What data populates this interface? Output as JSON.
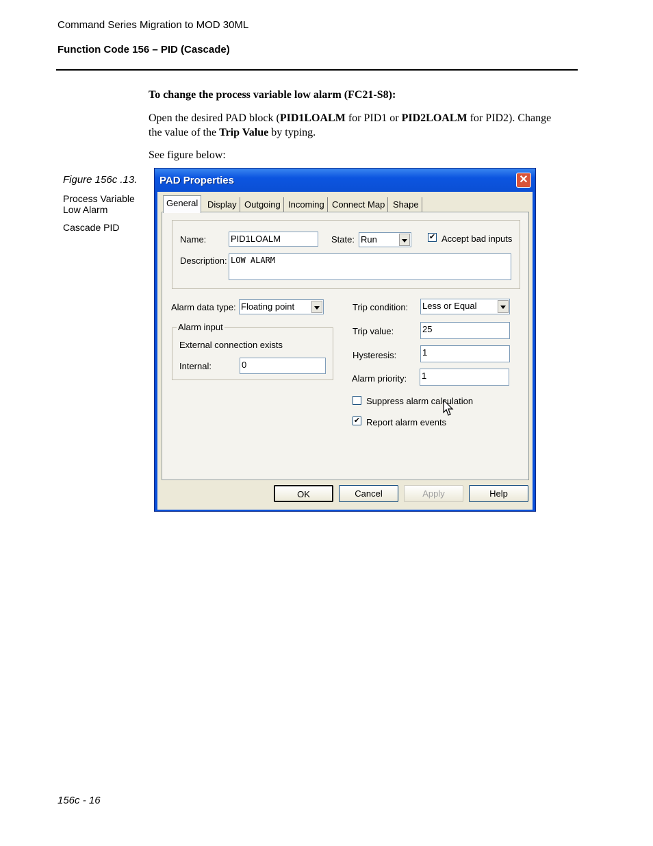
{
  "header": {
    "doc_title": "Command Series Migration to MOD 30ML",
    "section_title": "Function Code 156 – PID (Cascade)"
  },
  "body": {
    "heading": "To change the process variable low alarm (FC21-S8):",
    "para_open": "Open the desired PAD block (",
    "para_b1": "PID1LOALM",
    "para_mid1": " for PID1 or ",
    "para_b2": "PID2LOALM",
    "para_mid2": " for PID2). Change the value of the ",
    "para_b3": "Trip Value",
    "para_end": " by typing.",
    "see_figure": "See figure below:"
  },
  "caption": {
    "figure": "Figure 156c .13.",
    "line1": "Process Variable Low Alarm",
    "line2": "Cascade PID"
  },
  "dialog": {
    "title": "PAD Properties",
    "close_glyph": "✕",
    "tabs": [
      "General",
      "Display",
      "Outgoing",
      "Incoming",
      "Connect Map",
      "Shape"
    ],
    "name_label": "Name:",
    "name_value": "PID1LOALM",
    "state_label": "State:",
    "state_value": "Run",
    "accept_bad_label": "Accept bad inputs",
    "accept_bad_checked": true,
    "description_label": "Description:",
    "description_value": "LOW ALARM",
    "alarm_data_type_label": "Alarm data type:",
    "alarm_data_type_value": "Floating point",
    "alarm_input_legend": "Alarm input",
    "external_connection_text": "External connection exists",
    "internal_label": "Internal:",
    "internal_value": "0",
    "trip_condition_label": "Trip condition:",
    "trip_condition_value": "Less or Equal",
    "trip_value_label": "Trip value:",
    "trip_value": "25",
    "hysteresis_label": "Hysteresis:",
    "hysteresis_value": "1",
    "alarm_priority_label": "Alarm priority:",
    "alarm_priority_value": "1",
    "suppress_label": "Suppress alarm calculation",
    "suppress_checked": false,
    "report_label": "Report alarm events",
    "report_checked": true,
    "buttons": {
      "ok": "OK",
      "cancel": "Cancel",
      "apply": "Apply",
      "help": "Help"
    },
    "check_glyph": "✔"
  },
  "footer": {
    "page": "156c - 16"
  }
}
